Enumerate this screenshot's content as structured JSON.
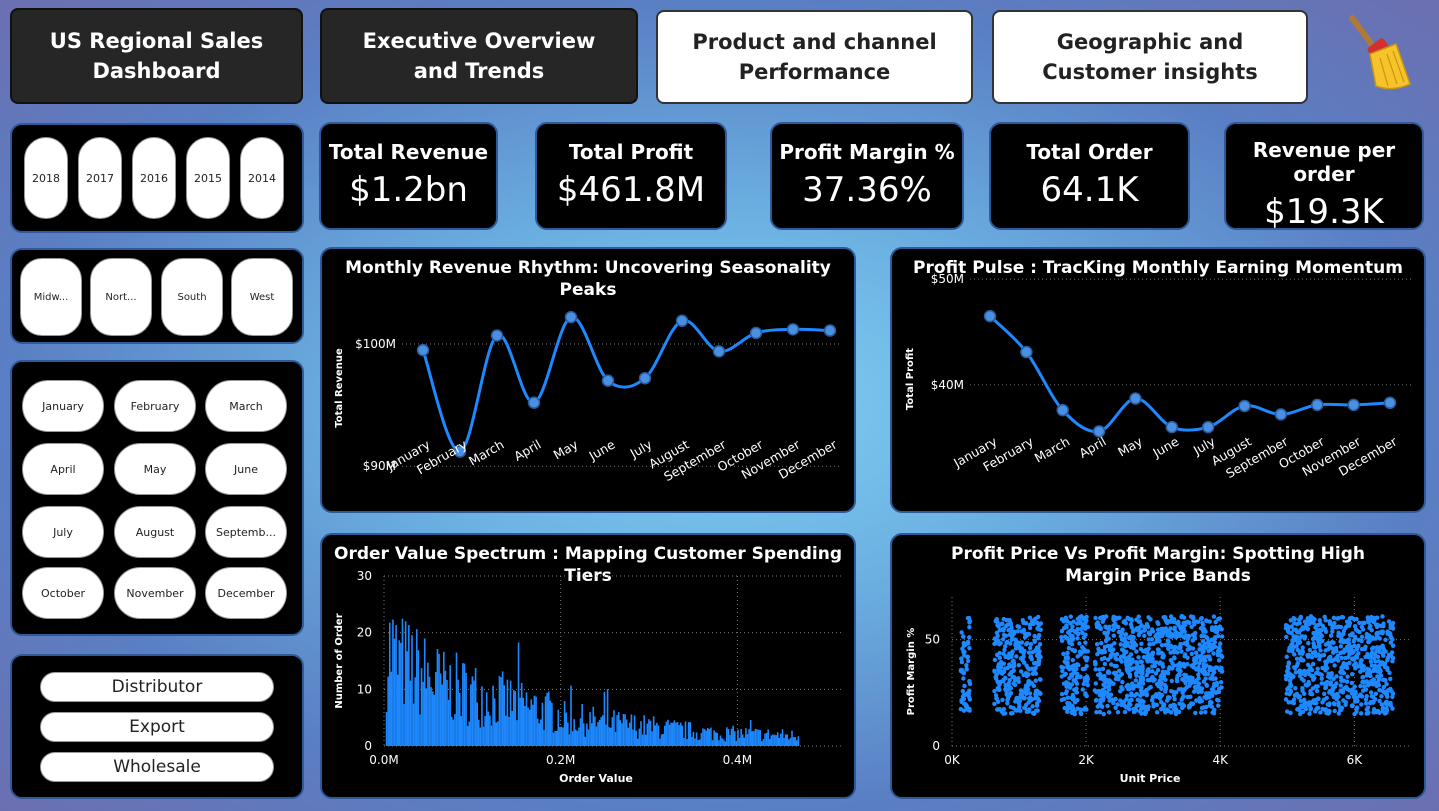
{
  "header": {
    "title": "US Regional Sales Dashboard",
    "tabs": [
      {
        "label": "Executive Overview and Trends"
      },
      {
        "label": "Product and channel Performance"
      },
      {
        "label": "Geographic and Customer insights"
      }
    ],
    "clear_icon": "broom-icon"
  },
  "filters": {
    "years": [
      "2018",
      "2017",
      "2016",
      "2015",
      "2014"
    ],
    "regions": [
      "Midw...",
      "Nort...",
      "South",
      "West"
    ],
    "months": [
      "January",
      "February",
      "March",
      "April",
      "May",
      "June",
      "July",
      "August",
      "Septemb...",
      "October",
      "November",
      "December"
    ],
    "channels": [
      "Distributor",
      "Export",
      "Wholesale"
    ]
  },
  "kpis": [
    {
      "title": "Total Revenue",
      "value": "$1.2bn"
    },
    {
      "title": "Total Profit",
      "value": "$461.8M"
    },
    {
      "title": "Profit Margin %",
      "value": "37.36%"
    },
    {
      "title": "Total Order",
      "value": "64.1K"
    },
    {
      "title": "Revenue per order",
      "value": "$19.3K"
    }
  ],
  "colors": {
    "accent": "#1e88ff",
    "panel": "#000000",
    "border": "#2f5a9a"
  },
  "chart_data": [
    {
      "type": "line",
      "title": "Monthly Revenue Rhythm: Uncovering Seasonality Peaks",
      "xlabel": "",
      "ylabel": "Total Revenue",
      "categories": [
        "January",
        "February",
        "March",
        "April",
        "May",
        "June",
        "July",
        "August",
        "September",
        "October",
        "November",
        "December"
      ],
      "values": [
        99.5,
        91.2,
        100.7,
        95.2,
        102.2,
        97.0,
        97.2,
        101.9,
        99.4,
        100.9,
        101.2,
        101.1
      ],
      "yticks": [
        "$90M",
        "$100M"
      ],
      "ylim": [
        88.3,
        104.5
      ],
      "unit": "M"
    },
    {
      "type": "line",
      "title": "Profit Pulse : TracKing Monthly Earning Momentum",
      "xlabel": "",
      "ylabel": "Total Profit",
      "categories": [
        "January",
        "February",
        "March",
        "April",
        "May",
        "June",
        "July",
        "August",
        "September",
        "October",
        "November",
        "December"
      ],
      "values": [
        46.5,
        43.1,
        37.6,
        35.6,
        38.7,
        36.0,
        36.0,
        38.0,
        37.2,
        38.1,
        38.1,
        38.3
      ],
      "yticks": [
        "$40M",
        "$50M"
      ],
      "ylim": [
        30.9,
        50.2
      ],
      "unit": "M"
    },
    {
      "type": "bar",
      "title": "Order Value Spectrum : Mapping Customer Spending Tiers",
      "xlabel": "Order Value",
      "ylabel": "Number of Order",
      "xticks": [
        "0.0M",
        "0.2M",
        "0.4M"
      ],
      "yticks": [
        "0",
        "10",
        "20",
        "30"
      ],
      "xlim": [
        0,
        0.48
      ],
      "ylim": [
        0,
        30
      ]
    },
    {
      "type": "scatter",
      "title": "Profit Price Vs Profit Margin: Spotting High Margin Price Bands",
      "xlabel": "Unit Price",
      "ylabel": "Profit Margin %",
      "xticks": [
        "0K",
        "2K",
        "4K",
        "6K"
      ],
      "yticks": [
        "0",
        "50"
      ],
      "xlim": [
        0,
        6800
      ],
      "ylim": [
        0,
        70
      ],
      "bands": [
        [
          130,
          270
        ],
        [
          630,
          1330
        ],
        [
          1630,
          2030
        ],
        [
          2130,
          4030
        ],
        [
          4980,
          6580
        ]
      ],
      "margin_range": [
        15,
        61
      ]
    }
  ]
}
